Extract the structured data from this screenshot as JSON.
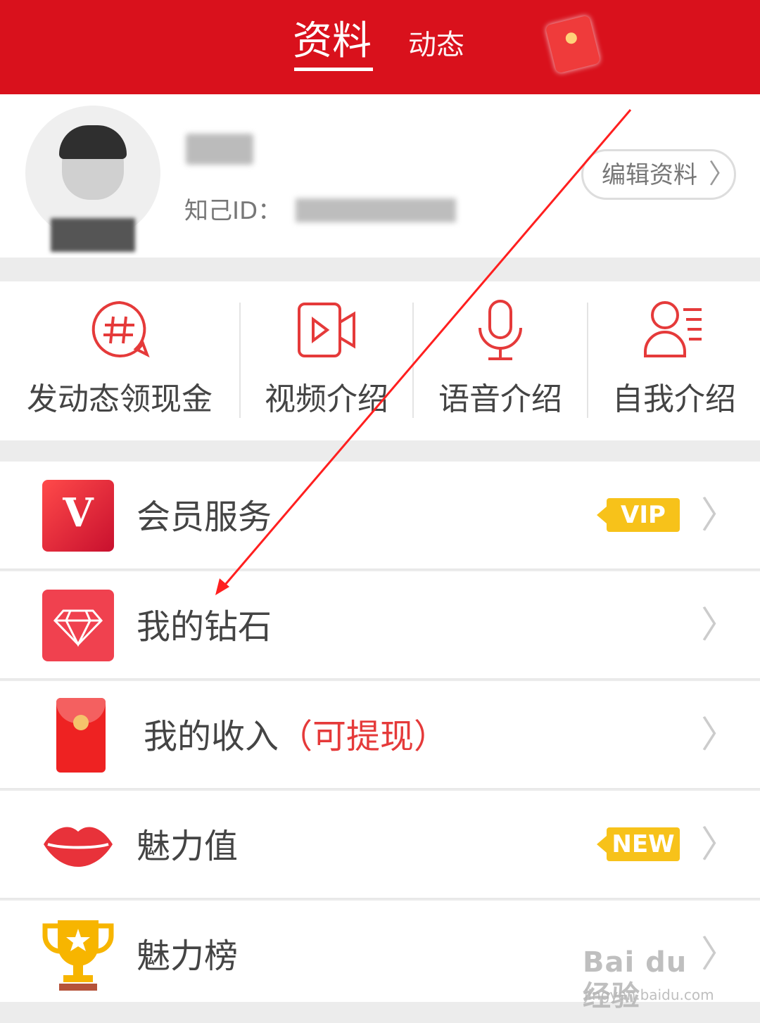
{
  "header": {
    "tab_active": "资料",
    "tab_inactive": "动态",
    "redpacket_icon": "red-packet-icon"
  },
  "profile": {
    "uid_label": "知己ID：",
    "edit_button": "编辑资料",
    "chevron": "〉"
  },
  "shortcuts": [
    {
      "label": "发动态领现金",
      "icon": "hashtag-bubble-icon"
    },
    {
      "label": "视频介绍",
      "icon": "video-camera-icon"
    },
    {
      "label": "语音介绍",
      "icon": "microphone-icon"
    },
    {
      "label": "自我介绍",
      "icon": "person-list-icon"
    }
  ],
  "menu": {
    "items": [
      {
        "label": "会员服务",
        "icon": "vip-v-icon",
        "tag": "VIP"
      },
      {
        "label": "我的钻石",
        "icon": "diamond-icon"
      },
      {
        "label": "我的收入",
        "label_extra": "（可提现）",
        "icon": "red-envelope-icon"
      },
      {
        "label": "魅力值",
        "icon": "lips-icon",
        "tag": "NEW"
      },
      {
        "label": "魅力榜",
        "icon": "trophy-icon"
      }
    ],
    "chevron": "〉"
  },
  "watermark": {
    "line1": "Bai du 经验",
    "line2": "jingyan.baidu.com"
  },
  "colors": {
    "brand_red": "#d9111c",
    "accent_red": "#e53a3a",
    "tag_yellow": "#f7c21a"
  }
}
